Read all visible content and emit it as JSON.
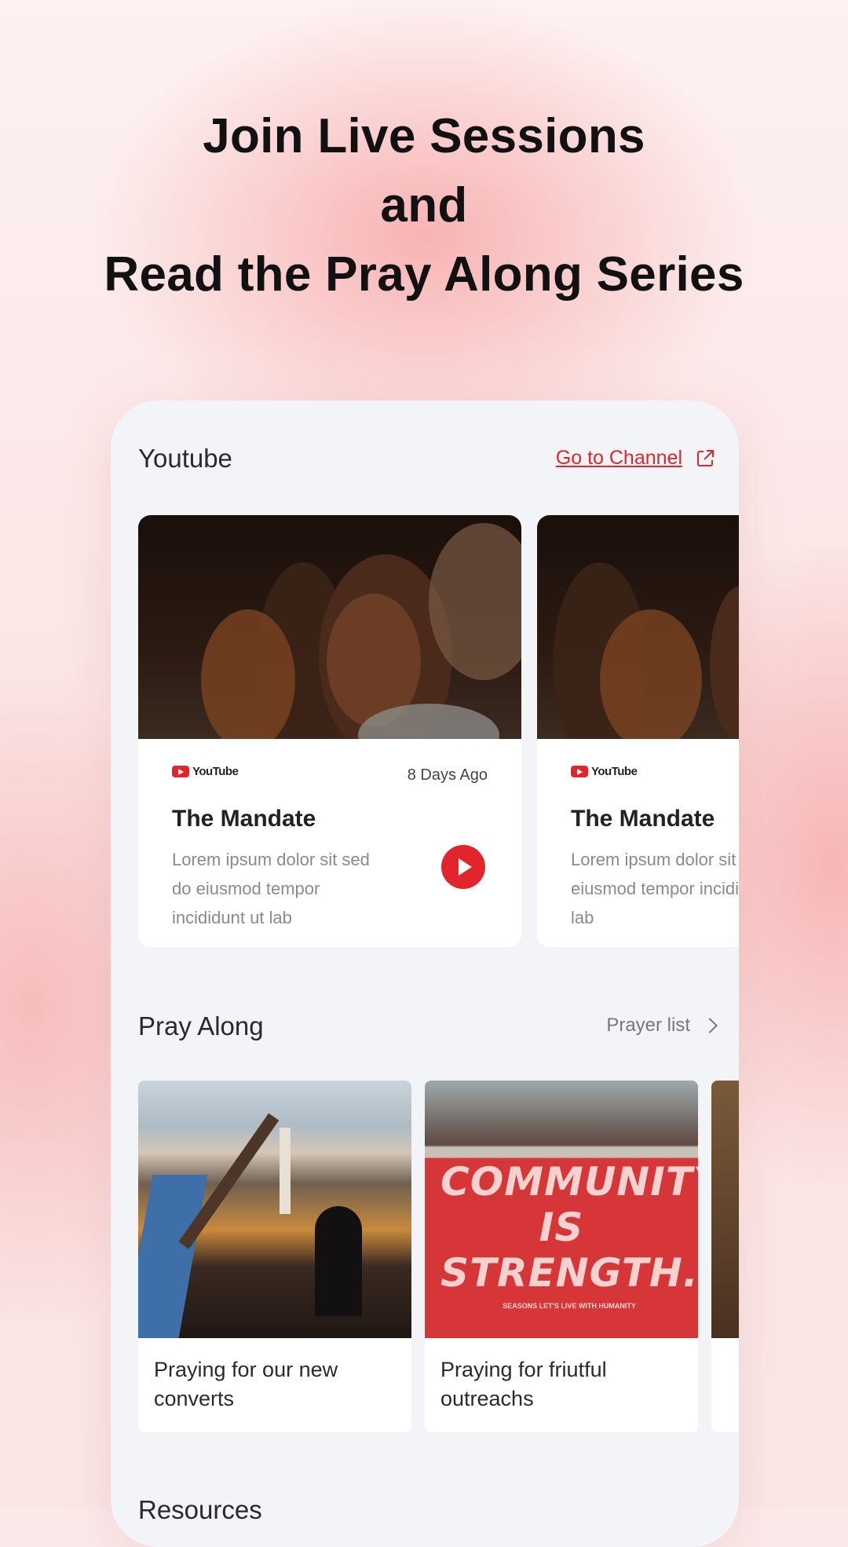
{
  "headline": {
    "line1": "Join Live Sessions",
    "line2": "and",
    "line3": "Read the Pray Along Series"
  },
  "youtube": {
    "section_title": "Youtube",
    "channel_link": "Go to Channel",
    "cards": [
      {
        "source": "YouTube",
        "age": "8 Days Ago",
        "title": "The Mandate",
        "description": "Lorem ipsum dolor sit sed do eiusmod tempor incididunt ut lab"
      },
      {
        "source": "YouTube",
        "title": "The Mandate",
        "description": "Lorem ipsum dolor sit sed do eiusmod tempor incididunt ut lab"
      }
    ]
  },
  "pray_along": {
    "section_title": "Pray Along",
    "list_link": "Prayer list",
    "cards": [
      {
        "caption": "Praying for our new converts"
      },
      {
        "caption": "Praying for friutful outreachs",
        "image_text": "COMMUNITY IS STRENGTH.",
        "image_subtext": "SEASONS LET'S LIVE WITH HUMANITY"
      }
    ]
  },
  "next_section_peek": "Resources",
  "colors": {
    "accent": "#e2242b",
    "background": "#f3f4f7"
  }
}
